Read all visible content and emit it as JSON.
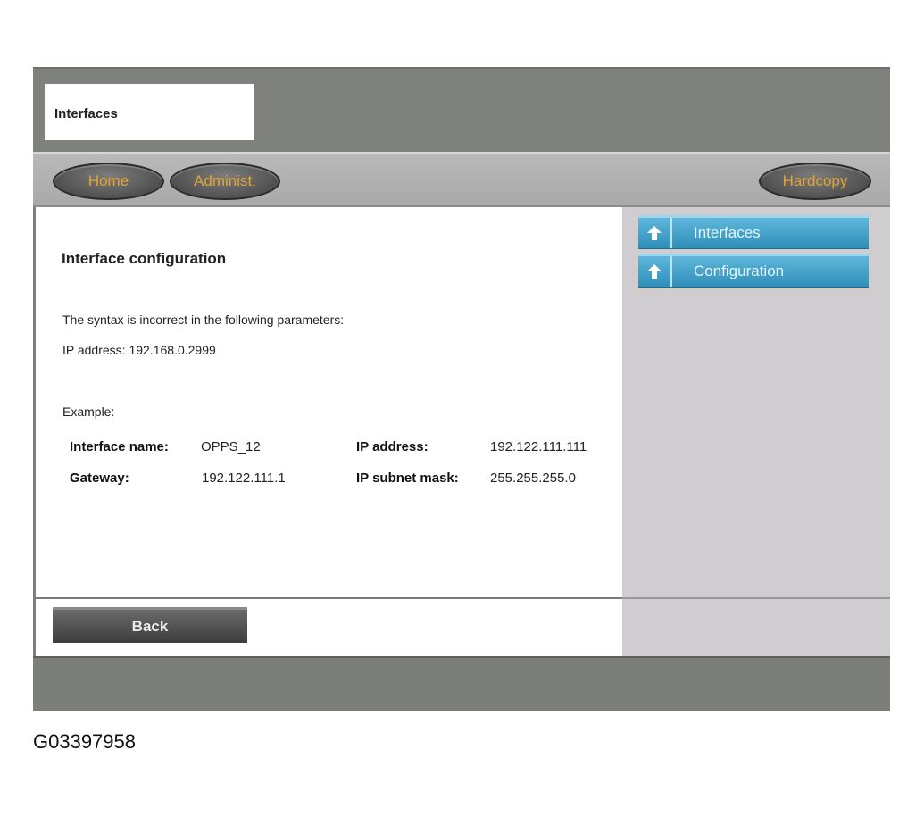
{
  "window": {
    "title": "Interfaces"
  },
  "nav": {
    "home_label": "Home",
    "admin_label": "Administ.",
    "hardcopy_label": "Hardcopy"
  },
  "main": {
    "section_title": "Interface configuration",
    "error_message": "The syntax is incorrect in the following parameters:",
    "error_param": "IP address:  192.168.0.2999",
    "example_label": "Example:",
    "example": {
      "interface_name_label": "Interface name:",
      "interface_name_value": "OPPS_12",
      "ip_address_label": "IP address:",
      "ip_address_value": "192.122.111.111",
      "gateway_label": "Gateway:",
      "gateway_value": "192.122.111.1",
      "subnet_mask_label": "IP subnet mask:",
      "subnet_mask_value": "255.255.255.0"
    },
    "back_label": "Back"
  },
  "side": {
    "items": [
      {
        "label": "Interfaces",
        "icon": "arrow-up-icon"
      },
      {
        "label": "Configuration",
        "icon": "arrow-up-icon"
      }
    ]
  },
  "colors": {
    "nav_text": "#e0a435",
    "side_button": "#2f8fba",
    "frame": "#7b7e79"
  },
  "image_code": "G03397958"
}
